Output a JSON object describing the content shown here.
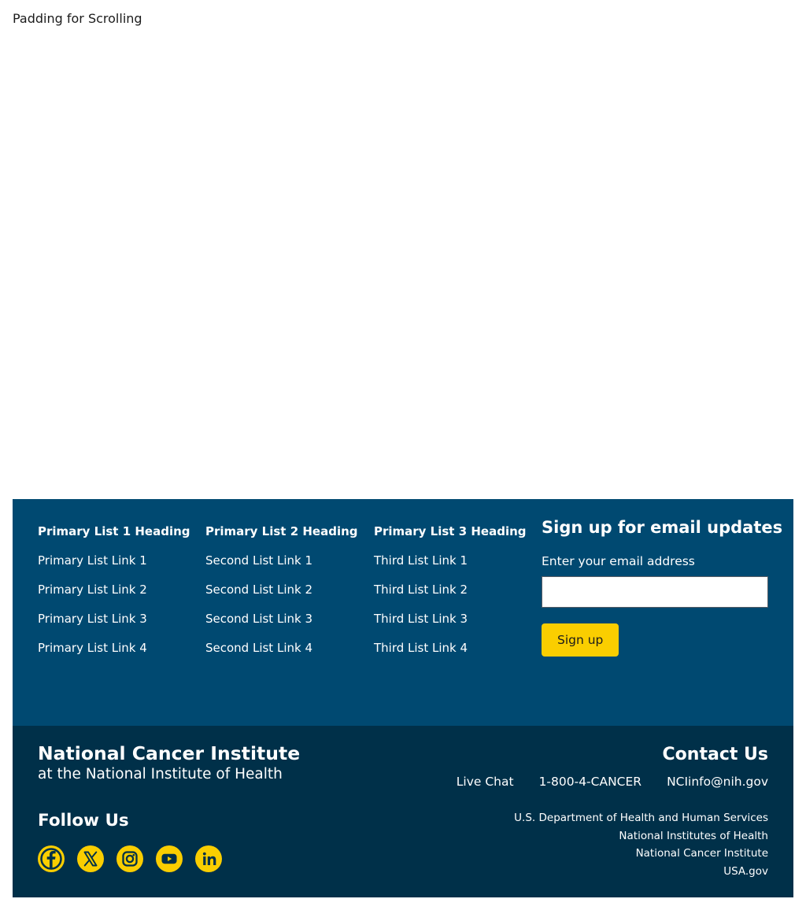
{
  "page": {
    "padding_text": "Padding for Scrolling"
  },
  "footer": {
    "lists": [
      {
        "heading": "Primary List 1 Heading",
        "links": [
          "Primary List Link 1",
          "Primary List Link 2",
          "Primary List Link 3",
          "Primary List Link 4"
        ]
      },
      {
        "heading": "Primary List 2 Heading",
        "links": [
          "Second List Link 1",
          "Second List Link 2",
          "Second List Link 3",
          "Second List Link 4"
        ]
      },
      {
        "heading": "Primary List 3 Heading",
        "links": [
          "Third List Link 1",
          "Third List Link 2",
          "Third List Link 3",
          "Third List Link 4"
        ]
      }
    ],
    "signup": {
      "title": "Sign up for email updates",
      "email_label": "Enter your email address",
      "email_value": "",
      "button_label": "Sign up"
    },
    "logo": {
      "name": "National Cancer Institute",
      "subtitle": "at the National Institute of Health"
    },
    "follow": {
      "title": "Follow Us",
      "icons": [
        "facebook-icon",
        "x-icon",
        "instagram-icon",
        "youtube-icon",
        "linkedin-icon"
      ]
    },
    "contact": {
      "title": "Contact Us",
      "links": [
        "Live Chat",
        "1-800-4-CANCER",
        "NCIinfo@nih.gov"
      ]
    },
    "agencies": [
      "U.S. Department of Health and Human Services",
      "National Institutes of Health",
      "National Cancer Institute",
      "USA.gov"
    ]
  },
  "colors": {
    "primary_bg": "#004971",
    "secondary_bg": "#003049",
    "accent": "#face00",
    "text_light": "#ffffff"
  }
}
